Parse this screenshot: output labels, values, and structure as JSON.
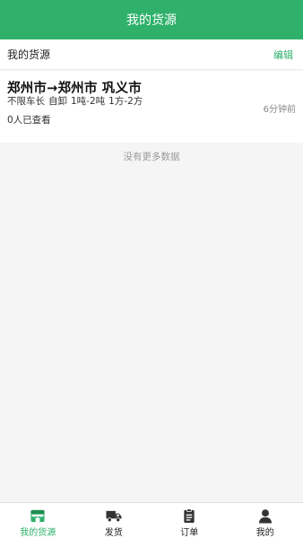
{
  "header": {
    "title": "我的货源"
  },
  "section": {
    "label": "我的货源",
    "edit_label": "编辑"
  },
  "cargo_list": [
    {
      "route": "郑州市→郑州市 巩义市",
      "truck_length": "不限车长",
      "unload": "自卸",
      "weight": "1吨-2吨",
      "volume": "1方-2方",
      "time_ago": "6分钟前",
      "views": "0人已查看"
    }
  ],
  "empty_text": "没有更多数据",
  "tabbar": {
    "tabs": [
      {
        "label": "我的货源",
        "icon": "store-icon",
        "active": true
      },
      {
        "label": "发货",
        "icon": "truck-icon",
        "active": false
      },
      {
        "label": "订单",
        "icon": "clipboard-icon",
        "active": false
      },
      {
        "label": "我的",
        "icon": "user-icon",
        "active": false
      }
    ]
  },
  "colors": {
    "brand": "#2fb16b",
    "background": "#f5f5f5",
    "muted_text": "#999999"
  }
}
